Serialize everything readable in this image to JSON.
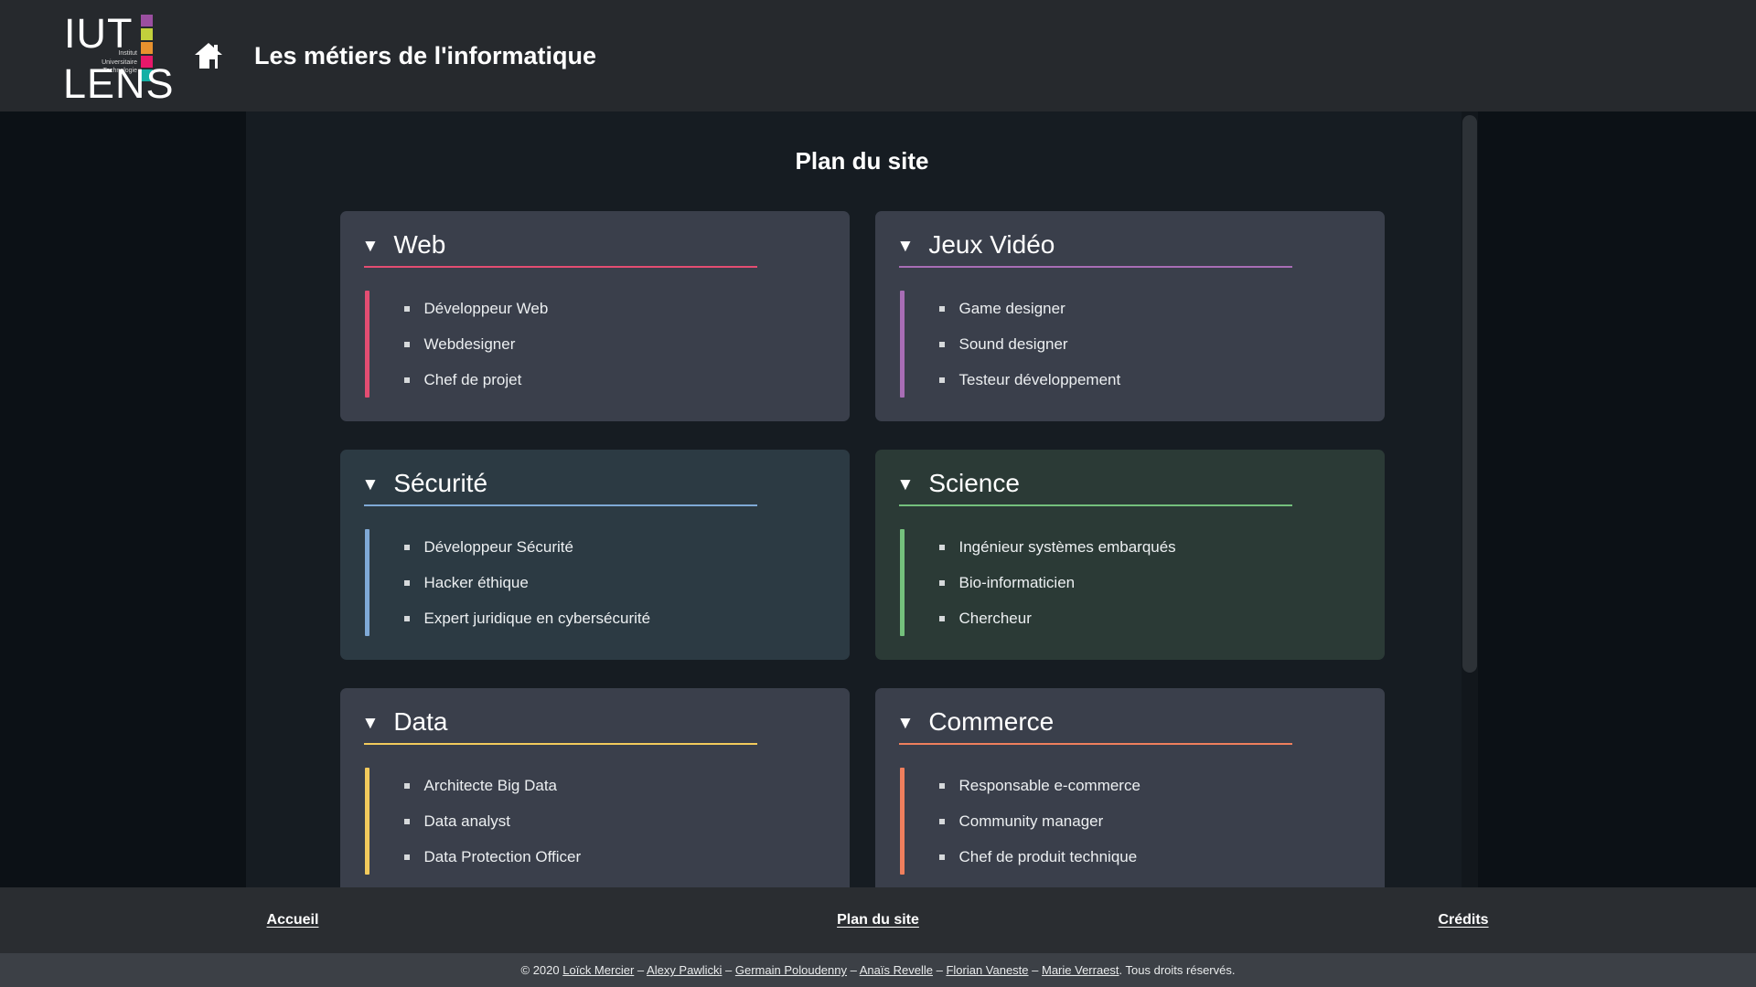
{
  "header": {
    "logo": {
      "primary_text": "IUT",
      "secondary_text": "LENS",
      "subtitle_line1": "Institut",
      "subtitle_line2": "Universitaire",
      "subtitle_line3": "Technologie",
      "swatch_colors": [
        "#9b4fa0",
        "#c2d03c",
        "#e8922e",
        "#e6186a",
        "#13b0a5"
      ]
    },
    "home_icon": "home-icon",
    "title": "Les métiers de l'informatique"
  },
  "main": {
    "page_title": "Plan du site",
    "categories": [
      {
        "name": "Web",
        "caret": "▼",
        "accent": "#e34d72",
        "tint": "",
        "items": [
          "Développeur Web",
          "Webdesigner",
          "Chef de projet"
        ]
      },
      {
        "name": "Jeux Vidéo",
        "caret": "▼",
        "accent": "#a86db5",
        "tint": "",
        "items": [
          "Game designer",
          "Sound designer",
          "Testeur développement"
        ]
      },
      {
        "name": "Sécurité",
        "caret": "▼",
        "accent": "#7fa9d6",
        "tint": "tint-blue",
        "items": [
          "Développeur Sécurité",
          "Hacker éthique",
          "Expert juridique en cybersécurité"
        ]
      },
      {
        "name": "Science",
        "caret": "▼",
        "accent": "#74c07c",
        "tint": "tint-green",
        "items": [
          "Ingénieur systèmes embarqués",
          "Bio-informaticien",
          "Chercheur"
        ]
      },
      {
        "name": "Data",
        "caret": "▼",
        "accent": "#f2ca5c",
        "tint": "",
        "items": [
          "Architecte Big Data",
          "Data analyst",
          "Data Protection Officer"
        ]
      },
      {
        "name": "Commerce",
        "caret": "▼",
        "accent": "#ef7f5d",
        "tint": "",
        "items": [
          "Responsable e-commerce",
          "Community manager",
          "Chef de produit technique"
        ]
      }
    ]
  },
  "footer": {
    "nav": [
      {
        "label": "Accueil"
      },
      {
        "label": "Plan du site"
      },
      {
        "label": "Crédits"
      }
    ],
    "legal": {
      "prefix": "© 2020 ",
      "authors": [
        "Loïck Mercier",
        "Alexy Pawlicki",
        "Germain Poloudenny",
        "Anaïs Revelle",
        "Florian Vaneste",
        "Marie Verraest"
      ],
      "separator": " – ",
      "suffix": ". Tous droits réservés."
    }
  }
}
